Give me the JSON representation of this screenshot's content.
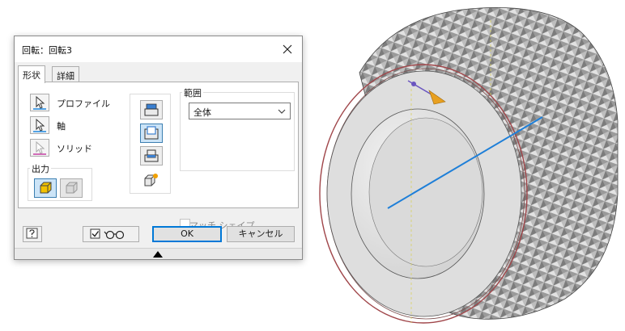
{
  "dialog": {
    "title": "回転：回転3",
    "close_icon": "close-icon",
    "tabs": [
      {
        "label": "形状",
        "active": true
      },
      {
        "label": "詳細",
        "active": false
      }
    ],
    "selectors": [
      {
        "label": "プロファイル",
        "icon": "cursor-select-icon",
        "enabled": true
      },
      {
        "label": "軸",
        "icon": "cursor-select-icon",
        "enabled": true
      },
      {
        "label": "ソリッド",
        "icon": "cursor-select-icon",
        "enabled": false
      }
    ],
    "output": {
      "title": "出力",
      "options": [
        {
          "icon": "solid-output-icon",
          "selected": true
        },
        {
          "icon": "surface-output-icon",
          "selected": false
        }
      ]
    },
    "operations": [
      {
        "icon": "join-icon",
        "selected": false
      },
      {
        "icon": "cut-icon",
        "selected": true
      },
      {
        "icon": "intersect-icon",
        "selected": false
      },
      {
        "icon": "new-solid-icon",
        "selected": false
      }
    ],
    "extent": {
      "title": "範囲",
      "selected": "全体"
    },
    "match_shape": {
      "label": "マッチ シェイプ",
      "checked": false,
      "enabled": false
    },
    "buttons": {
      "help_icon": "help-icon",
      "preview_checked": true,
      "preview_icon": "glasses-icon",
      "ok": "OK",
      "cancel": "キャンセル"
    },
    "expand_icon": "triangle-up-icon"
  },
  "colors": {
    "accent": "#0078d7",
    "selected_bg": "#cce4f7",
    "axis_line": "#1e7fd8",
    "direction_arrow": "#e8a020"
  }
}
